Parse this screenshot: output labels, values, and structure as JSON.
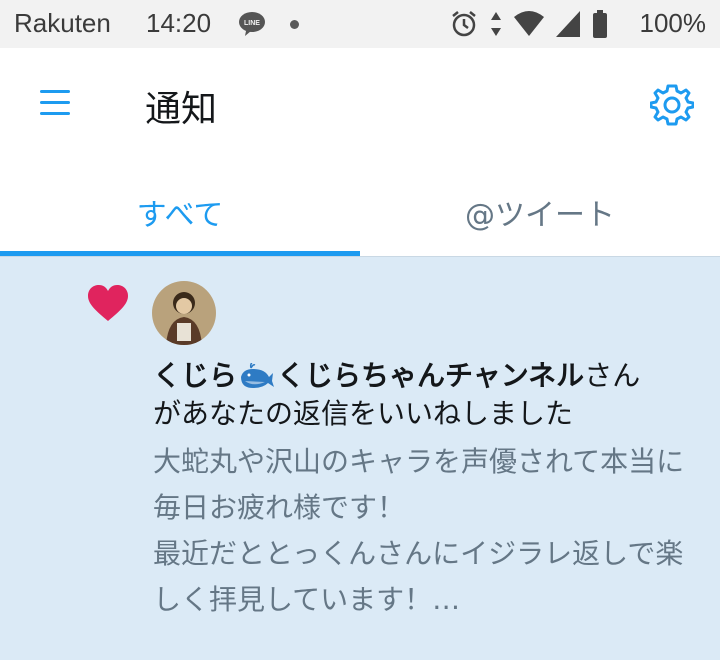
{
  "status_bar": {
    "carrier": "Rakuten",
    "time": "14:20",
    "battery_percent": "100%",
    "icons": [
      "line-app-icon",
      "notification-dot",
      "alarm-icon",
      "data-arrows-icon",
      "wifi-icon",
      "signal-icon",
      "battery-icon"
    ]
  },
  "header": {
    "title": "通知",
    "menu_icon": "hamburger-menu-icon",
    "settings_icon": "gear-icon",
    "accent_color": "#1d9bf0"
  },
  "tabs": [
    {
      "label": "すべて",
      "selected": true
    },
    {
      "label": "@ツイート",
      "selected": false
    }
  ],
  "notification": {
    "type_icon": "heart-icon",
    "user_name_part1": "くじら",
    "user_name_emoji": "whale-emoji",
    "user_name_part2": "くじらちゃんチャンネル",
    "name_suffix": "さん",
    "action_text": "があなたの返信をいいねしました",
    "quote_line1": "大蛇丸や沢山のキャラを声優されて本当に毎日お疲れ様です！",
    "quote_line2": "最近だととっくんさんにイジラレ返しで楽しく拝見しています！…",
    "background_color": "#dbeaf6",
    "heart_color": "#e0245e"
  }
}
